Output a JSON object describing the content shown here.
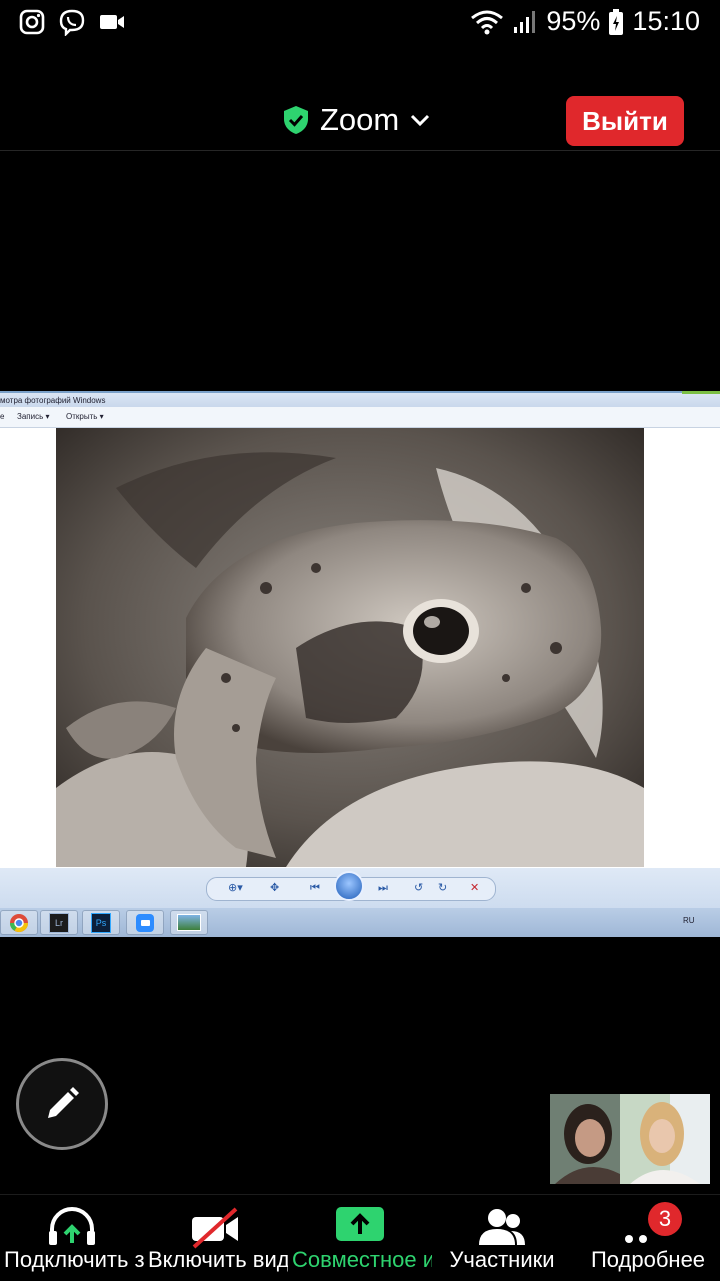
{
  "status_bar": {
    "left_icons": [
      "instagram-icon",
      "viber-icon",
      "zoom-video-icon"
    ],
    "battery": "95%",
    "time": "15:10"
  },
  "header": {
    "title": "Zoom",
    "leave_label": "Выйти",
    "accent_leave": "#e0282c",
    "shield_color": "#2ed36f"
  },
  "shared_screen": {
    "window_title": "мотра фотографий Windows",
    "menu": [
      "е",
      "Запись ▾",
      "Открыть ▾"
    ],
    "language": "RU"
  },
  "toolbar": {
    "items": [
      {
        "label": "Подключить звук",
        "icon": "headphones-icon"
      },
      {
        "label": "Включить видео",
        "icon": "video-off-icon"
      },
      {
        "label": "Совместное использование",
        "icon": "share-screen-icon"
      },
      {
        "label": "Участники",
        "icon": "participants-icon"
      },
      {
        "label": "Подробнее",
        "icon": "more-icon"
      }
    ],
    "more_badge": "3",
    "share_color": "#2ed36f"
  }
}
